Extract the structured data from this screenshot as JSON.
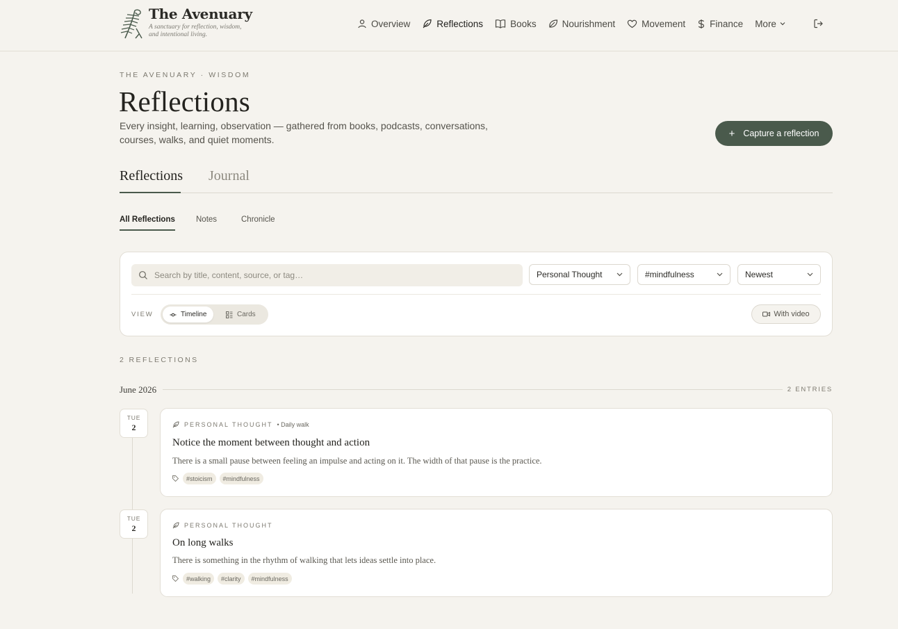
{
  "brand": {
    "name": "The Avenuary",
    "tagline": "A sanctuary for reflection, wisdom, and intentional living."
  },
  "nav": {
    "items": [
      {
        "label": "Overview",
        "icon": "user-icon"
      },
      {
        "label": "Reflections",
        "icon": "feather-icon",
        "active": true
      },
      {
        "label": "Books",
        "icon": "book-open-icon"
      },
      {
        "label": "Nourishment",
        "icon": "leaf-icon"
      },
      {
        "label": "Movement",
        "icon": "heart-icon"
      },
      {
        "label": "Finance",
        "icon": "dollar-icon"
      }
    ],
    "more_label": "More"
  },
  "page": {
    "eyebrow": "THE AVENUARY · WISDOM",
    "title": "Reflections",
    "description": "Every insight, learning, observation — gathered from books, podcasts, conversations, courses, walks, and quiet moments.",
    "capture_label": "Capture a reflection"
  },
  "main_tabs": [
    {
      "label": "Reflections",
      "active": true
    },
    {
      "label": "Journal",
      "active": false
    }
  ],
  "sub_tabs": [
    {
      "label": "All Reflections",
      "active": true
    },
    {
      "label": "Notes",
      "active": false
    },
    {
      "label": "Chronicle",
      "active": false
    }
  ],
  "filters": {
    "search_placeholder": "Search by title, content, source, or tag…",
    "category": "Personal Thought",
    "tag": "#mindfulness",
    "sort": "Newest",
    "view_label": "VIEW",
    "view_options": [
      "Timeline",
      "Cards"
    ],
    "view_selected": "Timeline",
    "with_video_label": "With video"
  },
  "results": {
    "count_label": "2 REFLECTIONS",
    "month": "June 2026",
    "month_count": "2 ENTRIES",
    "entries": [
      {
        "dow": "TUE",
        "day": "2",
        "category": "PERSONAL THOUGHT",
        "source": "• Daily walk",
        "title": "Notice the moment between thought and action",
        "body": "There is a small pause between feeling an impulse and acting on it. The width of that pause is the practice.",
        "tags": [
          "#stoicism",
          "#mindfulness"
        ]
      },
      {
        "dow": "TUE",
        "day": "2",
        "category": "PERSONAL THOUGHT",
        "source": "",
        "title": "On long walks",
        "body": "There is something in the rhythm of walking that lets ideas settle into place.",
        "tags": [
          "#walking",
          "#clarity",
          "#mindfulness"
        ]
      }
    ]
  },
  "colors": {
    "background": "#f5f3ee",
    "accent": "#4a5a4c",
    "card": "#ffffff",
    "tag_bg": "#f0ece2"
  }
}
